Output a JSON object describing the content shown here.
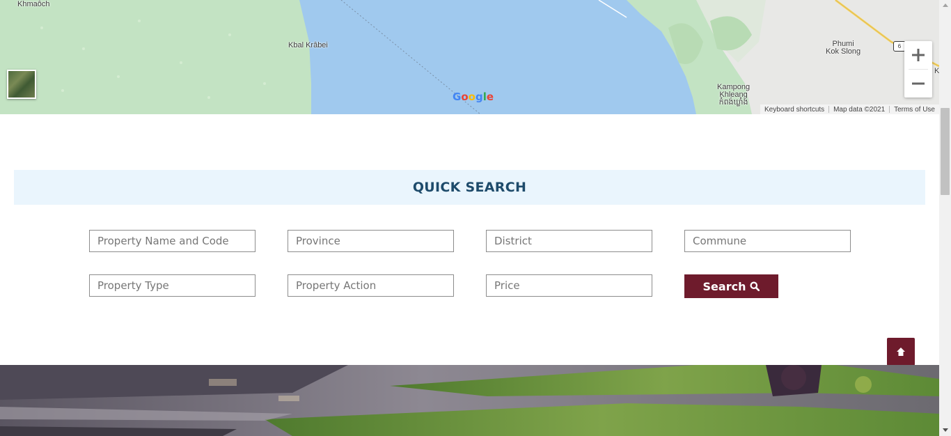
{
  "map": {
    "places": {
      "khmaoch": "Khmaôch",
      "kbal_krabei": "Kbal Krâbei",
      "phumi_kok_slong": "Phumi\nKok Slong",
      "kampong_khleang": "Kampong\nKhleang\nកំពង់ឃ្លាំង",
      "edge_letter": "K"
    },
    "route_number": "6",
    "google_logo_letters": [
      "G",
      "o",
      "o",
      "g",
      "l",
      "e"
    ],
    "google_logo_colors": [
      "#4285F4",
      "#EA4335",
      "#FBBC05",
      "#4285F4",
      "#34A853",
      "#EA4335"
    ],
    "footer": {
      "keyboard_shortcuts": "Keyboard shortcuts",
      "map_data": "Map data ©2021",
      "terms": "Terms of Use"
    },
    "zoom_in_icon": "plus-icon",
    "zoom_out_icon": "minus-icon",
    "water_color": "#a0c9ee",
    "land_color": "#c3e3c3"
  },
  "quick_search": {
    "title": "QUICK SEARCH",
    "fields": {
      "property_name": "Property Name and Code",
      "province": "Province",
      "district": "District",
      "commune": "Commune",
      "property_type": "Property Type",
      "property_action": "Property Action",
      "price": "Price"
    },
    "search_button": "Search",
    "search_icon": "search-icon",
    "accent_color": "#6e1b2c",
    "header_bg": "#eaf5fd"
  },
  "back_to_top_icon": "arrow-up-icon"
}
